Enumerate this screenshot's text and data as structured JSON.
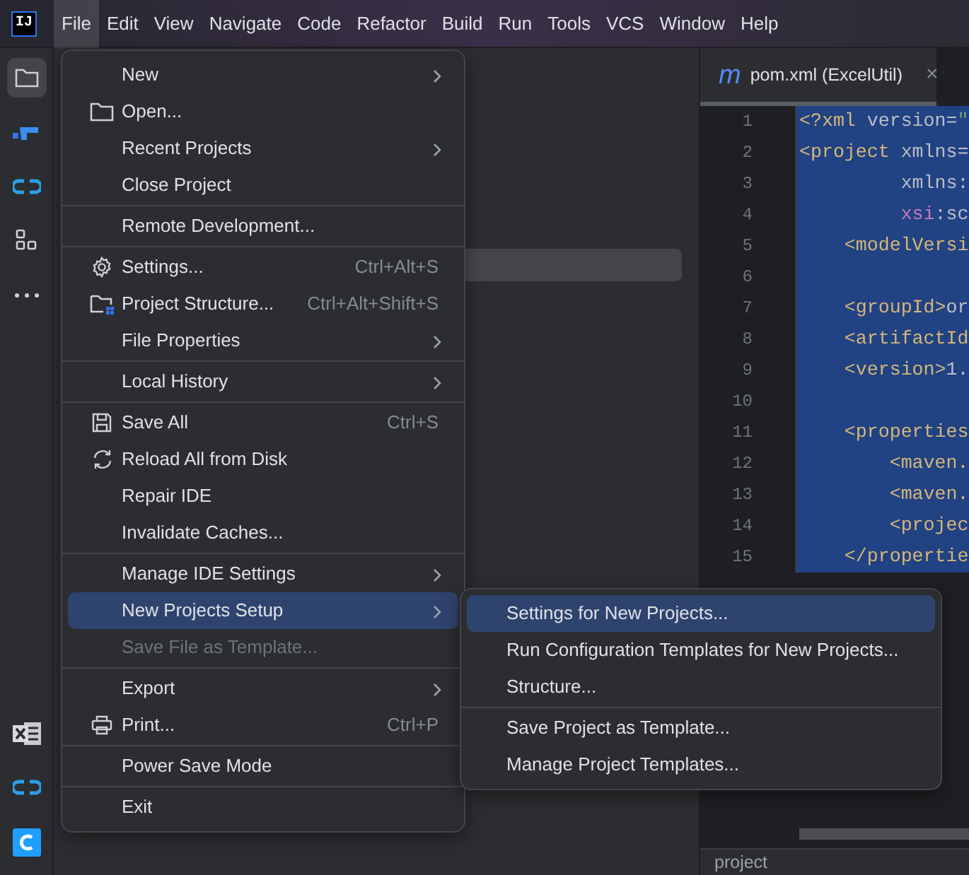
{
  "logo": "IJ",
  "menubar": [
    {
      "label": "File",
      "selected": true
    },
    {
      "label": "Edit",
      "selected": false
    },
    {
      "label": "View",
      "selected": false
    },
    {
      "label": "Navigate",
      "selected": false
    },
    {
      "label": "Code",
      "selected": false
    },
    {
      "label": "Refactor",
      "selected": false
    },
    {
      "label": "Build",
      "selected": false
    },
    {
      "label": "Run",
      "selected": false
    },
    {
      "label": "Tools",
      "selected": false
    },
    {
      "label": "VCS",
      "selected": false
    },
    {
      "label": "Window",
      "selected": false
    },
    {
      "label": "Help",
      "selected": false
    }
  ],
  "tool_buttons_top": [
    {
      "kind": "folder",
      "selected": true
    },
    {
      "kind": "structure",
      "selected": false
    },
    {
      "kind": "link",
      "selected": false
    },
    {
      "kind": "grid",
      "selected": false
    },
    {
      "kind": "more",
      "selected": false
    }
  ],
  "tool_buttons_bottom": [
    {
      "kind": "excel",
      "selected": false
    },
    {
      "kind": "link",
      "selected": false
    },
    {
      "kind": "c-app",
      "selected": false
    }
  ],
  "editor": {
    "tab": {
      "icon_text": "m",
      "title": "pom.xml (ExcelUtil)",
      "close": "×"
    },
    "lines": [
      {
        "number": "1",
        "segments": [
          {
            "text": "<?xml",
            "kind": "tag"
          },
          {
            "text": " version=",
            "kind": "attr"
          },
          {
            "text": "\"",
            "kind": "string"
          }
        ]
      },
      {
        "number": "2",
        "segments": [
          {
            "text": "<project",
            "kind": "tag"
          },
          {
            "text": " xmlns=",
            "kind": "attr"
          }
        ]
      },
      {
        "number": "3",
        "segments": [
          {
            "text": "         xmlns:",
            "kind": "attr"
          }
        ]
      },
      {
        "number": "4",
        "segments": [
          {
            "text": "         xsi",
            "kind": "ns"
          },
          {
            "text": ":sc",
            "kind": "attr"
          }
        ]
      },
      {
        "number": "5",
        "segments": [
          {
            "text": "    <modelVersi",
            "kind": "tag"
          }
        ]
      },
      {
        "number": "6"
      },
      {
        "number": "7",
        "segments": [
          {
            "text": "    <groupId>",
            "kind": "tag"
          },
          {
            "text": "or",
            "kind": "attr"
          }
        ]
      },
      {
        "number": "8",
        "segments": [
          {
            "text": "    <artifactId",
            "kind": "tag"
          }
        ]
      },
      {
        "number": "9",
        "segments": [
          {
            "text": "    <version>",
            "kind": "tag"
          },
          {
            "text": "1.",
            "kind": "attr"
          }
        ]
      },
      {
        "number": "10"
      },
      {
        "number": "11",
        "segments": [
          {
            "text": "    <properties",
            "kind": "tag"
          }
        ]
      },
      {
        "number": "12",
        "segments": [
          {
            "text": "        <maven.",
            "kind": "tag"
          }
        ]
      },
      {
        "number": "13",
        "segments": [
          {
            "text": "        <maven.",
            "kind": "tag"
          }
        ]
      },
      {
        "number": "14",
        "segments": [
          {
            "text": "        <projec",
            "kind": "tag"
          }
        ]
      },
      {
        "number": "15",
        "segments": [
          {
            "text": "    </propertie",
            "kind": "tag"
          }
        ]
      }
    ],
    "breadcrumb": "project"
  },
  "file_menu": [
    {
      "kind": "item",
      "label": "New",
      "submenu": true,
      "selected": false,
      "disabled": false
    },
    {
      "kind": "folder",
      "label": "Open...",
      "selected": false,
      "disabled": false
    },
    {
      "kind": "item",
      "label": "Recent Projects",
      "submenu": true,
      "selected": false,
      "disabled": false
    },
    {
      "kind": "item",
      "label": "Close Project",
      "selected": false,
      "disabled": false
    },
    {
      "kind": "separator"
    },
    {
      "kind": "item",
      "label": "Remote Development...",
      "selected": false,
      "disabled": false
    },
    {
      "kind": "separator"
    },
    {
      "kind": "gear",
      "label": "Settings...",
      "shortcut": "Ctrl+Alt+S",
      "selected": false,
      "disabled": false
    },
    {
      "kind": "project-structure",
      "label": "Project Structure...",
      "shortcut": "Ctrl+Alt+Shift+S",
      "selected": false,
      "disabled": false
    },
    {
      "kind": "item",
      "label": "File Properties",
      "submenu": true,
      "selected": false,
      "disabled": false
    },
    {
      "kind": "separator"
    },
    {
      "kind": "item",
      "label": "Local History",
      "submenu": true,
      "selected": false,
      "disabled": false
    },
    {
      "kind": "separator"
    },
    {
      "kind": "save",
      "label": "Save All",
      "shortcut": "Ctrl+S",
      "selected": false,
      "disabled": false
    },
    {
      "kind": "reload",
      "label": "Reload All from Disk",
      "selected": false,
      "disabled": false
    },
    {
      "kind": "item",
      "label": "Repair IDE",
      "selected": false,
      "disabled": false
    },
    {
      "kind": "item",
      "label": "Invalidate Caches...",
      "selected": false,
      "disabled": false
    },
    {
      "kind": "separator"
    },
    {
      "kind": "item",
      "label": "Manage IDE Settings",
      "submenu": true,
      "selected": false,
      "disabled": false
    },
    {
      "kind": "item",
      "label": "New Projects Setup",
      "submenu": true,
      "selected": true,
      "disabled": false
    },
    {
      "kind": "item",
      "label": "Save File as Template...",
      "selected": false,
      "disabled": true
    },
    {
      "kind": "separator"
    },
    {
      "kind": "item",
      "label": "Export",
      "submenu": true,
      "selected": false,
      "disabled": false
    },
    {
      "kind": "printer",
      "label": "Print...",
      "shortcut": "Ctrl+P",
      "selected": false,
      "disabled": false
    },
    {
      "kind": "separator"
    },
    {
      "kind": "item",
      "label": "Power Save Mode",
      "selected": false,
      "disabled": false
    },
    {
      "kind": "separator"
    },
    {
      "kind": "item",
      "label": "Exit",
      "selected": false,
      "disabled": false
    }
  ],
  "submenu": [
    {
      "kind": "item",
      "label": "Settings for New Projects...",
      "selected": true,
      "disabled": false
    },
    {
      "kind": "item",
      "label": "Run Configuration Templates for New Projects...",
      "selected": false,
      "disabled": false
    },
    {
      "kind": "item",
      "label": "Structure...",
      "selected": false,
      "disabled": false
    },
    {
      "kind": "separator"
    },
    {
      "kind": "item",
      "label": "Save Project as Template...",
      "selected": false,
      "disabled": false
    },
    {
      "kind": "item",
      "label": "Manage Project Templates...",
      "selected": false,
      "disabled": false
    }
  ]
}
